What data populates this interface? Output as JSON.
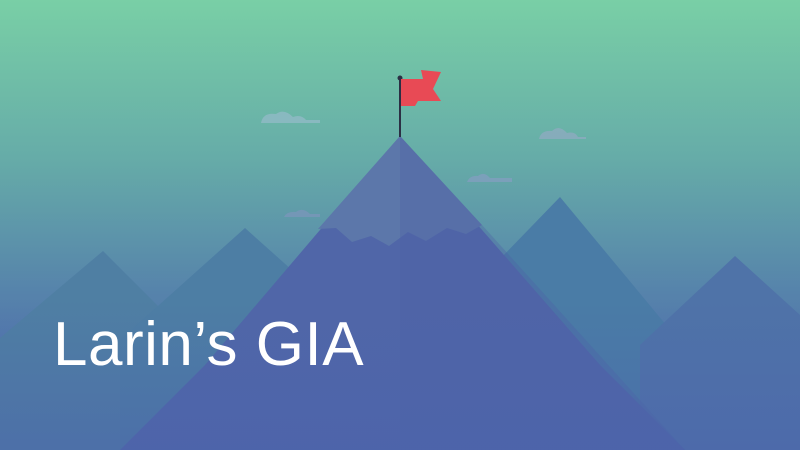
{
  "banner": {
    "title": "Larin’s GIA"
  },
  "icons": {
    "flag": "flag-icon"
  },
  "colors": {
    "sky_top": "#78cda5",
    "sky_mid": "#5d97a9",
    "sky_bottom": "#4d64ab",
    "flag": "#e84a55",
    "text": "#ffffff"
  }
}
